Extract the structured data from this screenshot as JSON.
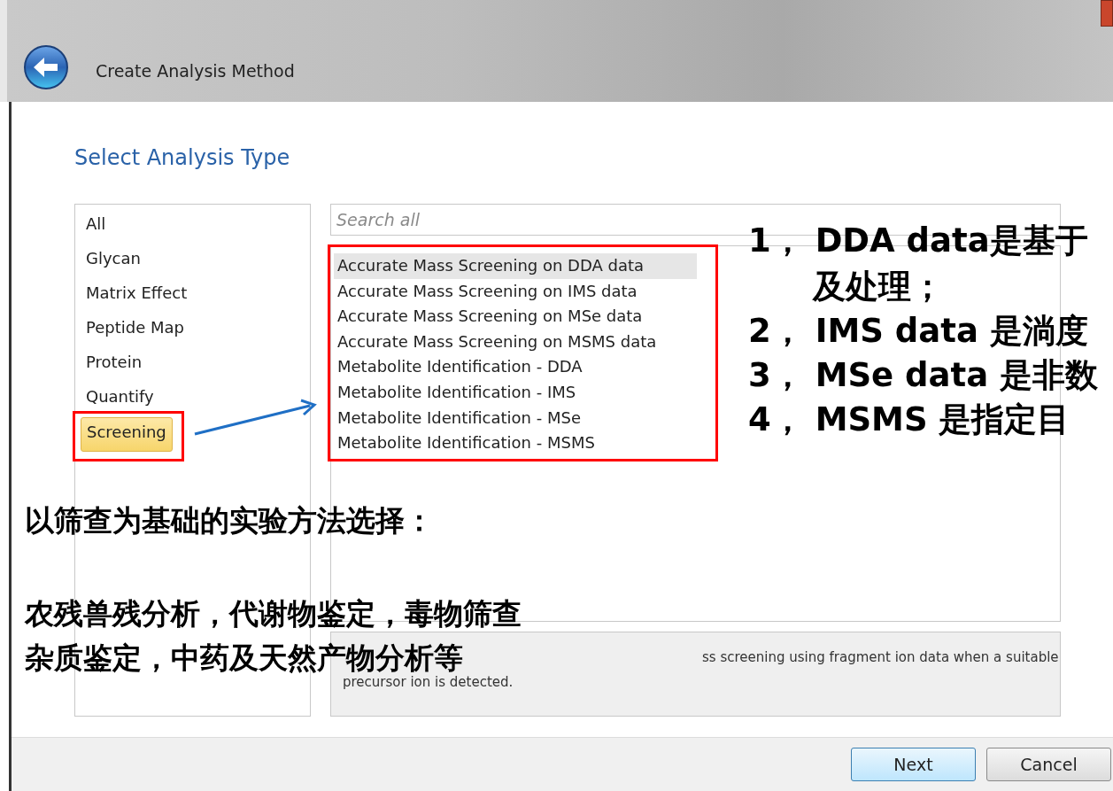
{
  "window": {
    "title": "Create Analysis Method"
  },
  "heading": "Select Analysis Type",
  "categories": [
    {
      "label": "All",
      "selected": false
    },
    {
      "label": "Glycan",
      "selected": false
    },
    {
      "label": "Matrix Effect",
      "selected": false
    },
    {
      "label": "Peptide Map",
      "selected": false
    },
    {
      "label": "Protein",
      "selected": false
    },
    {
      "label": "Quantify",
      "selected": false
    },
    {
      "label": "Screening",
      "selected": true
    }
  ],
  "search": {
    "placeholder": "Search all"
  },
  "methods": [
    {
      "label": "Accurate Mass Screening on DDA data",
      "selected": true
    },
    {
      "label": "Accurate Mass Screening on IMS data",
      "selected": false
    },
    {
      "label": "Accurate Mass Screening on MSe data",
      "selected": false
    },
    {
      "label": "Accurate Mass Screening on MSMS data",
      "selected": false
    },
    {
      "label": "Metabolite Identification - DDA",
      "selected": false
    },
    {
      "label": "Metabolite Identification - IMS",
      "selected": false
    },
    {
      "label": "Metabolite Identification - MSe",
      "selected": false
    },
    {
      "label": "Metabolite Identification - MSMS",
      "selected": false
    }
  ],
  "description_lines": [
    "ss screening using fragment ion data when a suitable",
    "precursor ion is detected."
  ],
  "buttons": [
    {
      "label": "Next",
      "kind": "default"
    },
    {
      "label": "Cancel",
      "kind": "normal"
    }
  ],
  "annotations": {
    "left_lines": [
      "以筛查为基础的实验方法选择：",
      "农残兽残分析，代谢物鉴定，毒物筛查",
      "杂质鉴定，中药及天然产物分析等"
    ],
    "right_lines": [
      "1， DDA data是基于",
      "及处理；",
      "2， IMS data 是淌度",
      "3， MSe data 是非数",
      "4， MSMS 是指定目"
    ]
  }
}
